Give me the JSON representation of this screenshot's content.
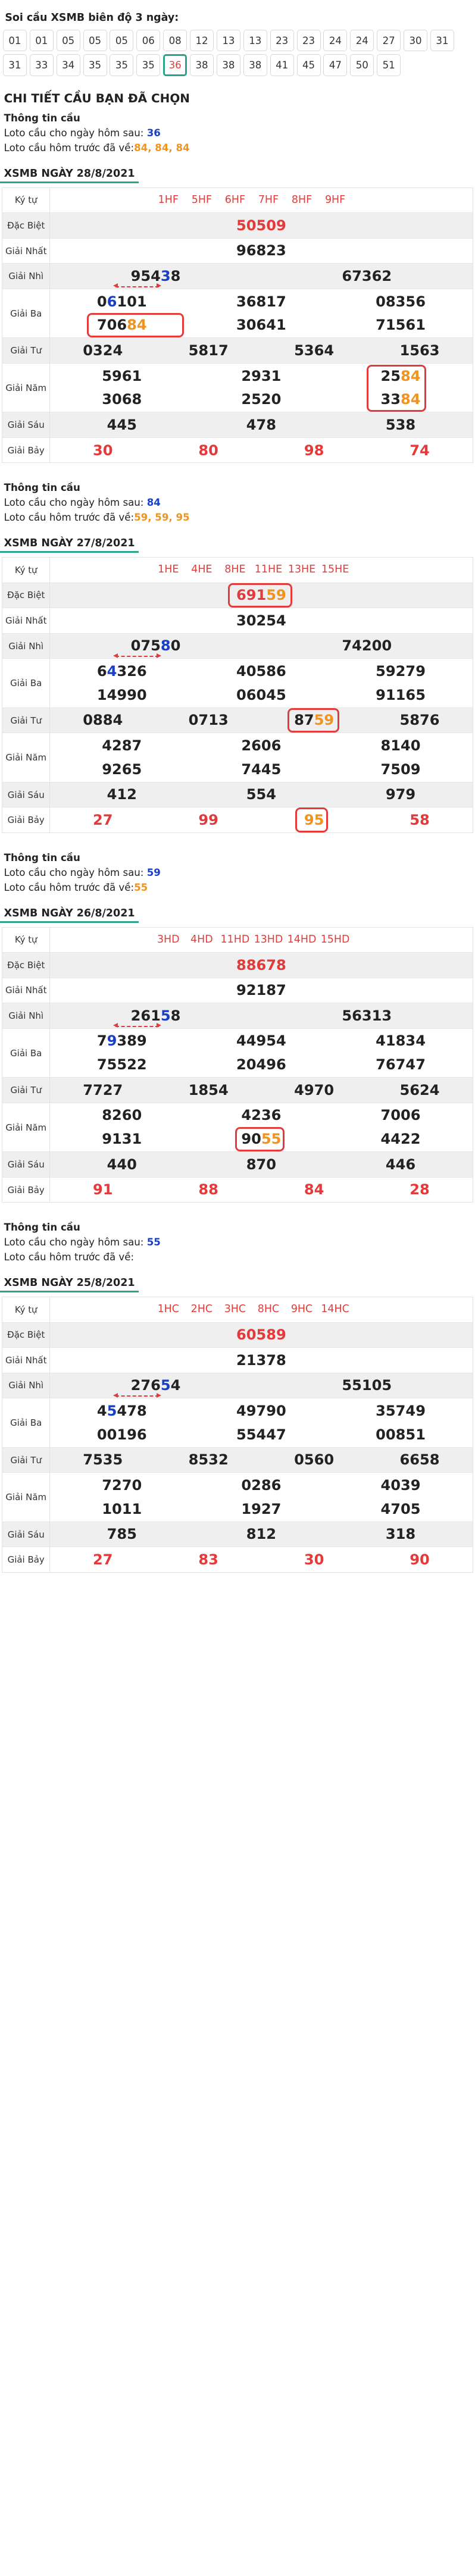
{
  "header": {
    "title": "Soi cầu XSMB biên độ 3 ngày:"
  },
  "chips": {
    "row1": [
      "01",
      "01",
      "05",
      "05",
      "05",
      "06",
      "08",
      "12",
      "13",
      "13",
      "23",
      "23",
      "24",
      "24",
      "27",
      "30",
      "31"
    ],
    "row2": [
      "31",
      "33",
      "34",
      "35",
      "35",
      "35",
      "36",
      "38",
      "38",
      "38",
      "41",
      "45",
      "47",
      "50",
      "51"
    ],
    "selected_index_row2": 6
  },
  "detail_title": "CHI TIẾT CẦU BẠN ĐÃ CHỌN",
  "info_label_next": "Loto cầu cho ngày hôm sau:",
  "info_label_prev": "Loto cầu hôm trước đã về:",
  "info_heading": "Thông tin cầu",
  "labels": {
    "kytu": "Ký tự",
    "db": "Đặc Biệt",
    "g1": "Giải Nhất",
    "g2": "Giải Nhì",
    "g3": "Giải Ba",
    "g4": "Giải Tư",
    "g5": "Giải Năm",
    "g6": "Giải Sáu",
    "g7": "Giải Bảy"
  },
  "sections": [
    {
      "info_next": "36",
      "info_prev": "84, 84, 84",
      "date": "XSMB NGÀY 28/8/2021",
      "kytu": [
        "1HF",
        "5HF",
        "6HF",
        "7HF",
        "8HF",
        "9HF"
      ],
      "db": "50509",
      "g1": "96823",
      "g2": [
        "95438",
        "67362"
      ],
      "g3": [
        "06101",
        "36817",
        "08356",
        "70684",
        "30641",
        "71561"
      ],
      "g4": [
        "0324",
        "5817",
        "5364",
        "1563"
      ],
      "g5": [
        "5961",
        "2931",
        "2584",
        "3068",
        "2520",
        "3384"
      ],
      "g6": [
        "445",
        "478",
        "538"
      ],
      "g7": [
        "30",
        "80",
        "98",
        "74"
      ]
    },
    {
      "info_next": "84",
      "info_prev": "59, 59, 95",
      "date": "XSMB NGÀY 27/8/2021",
      "kytu": [
        "1HE",
        "4HE",
        "8HE",
        "11HE",
        "13HE",
        "15HE"
      ],
      "db": "69159",
      "g1": "30254",
      "g2": [
        "07580",
        "74200"
      ],
      "g3": [
        "64326",
        "40586",
        "59279",
        "14990",
        "06045",
        "91165"
      ],
      "g4": [
        "0884",
        "0713",
        "8759",
        "5876"
      ],
      "g5": [
        "4287",
        "2606",
        "8140",
        "9265",
        "7445",
        "7509"
      ],
      "g6": [
        "412",
        "554",
        "979"
      ],
      "g7": [
        "27",
        "99",
        "95",
        "58"
      ]
    },
    {
      "info_next": "59",
      "info_prev": "55",
      "date": "XSMB NGÀY 26/8/2021",
      "kytu": [
        "3HD",
        "4HD",
        "11HD",
        "13HD",
        "14HD",
        "15HD"
      ],
      "db": "88678",
      "g1": "92187",
      "g2": [
        "26158",
        "56313"
      ],
      "g3": [
        "79389",
        "44954",
        "41834",
        "75522",
        "20496",
        "76747"
      ],
      "g4": [
        "7727",
        "1854",
        "4970",
        "5624"
      ],
      "g5": [
        "8260",
        "4236",
        "7006",
        "9131",
        "9055",
        "4422"
      ],
      "g6": [
        "440",
        "870",
        "446"
      ],
      "g7": [
        "91",
        "88",
        "84",
        "28"
      ]
    },
    {
      "info_next": "55",
      "info_prev": "",
      "date": "XSMB NGÀY 25/8/2021",
      "kytu": [
        "1HC",
        "2HC",
        "3HC",
        "8HC",
        "9HC",
        "14HC"
      ],
      "db": "60589",
      "g1": "21378",
      "g2": [
        "27654",
        "55105"
      ],
      "g3": [
        "45478",
        "49790",
        "35749",
        "00196",
        "55447",
        "00851"
      ],
      "g4": [
        "7535",
        "8532",
        "0560",
        "6658"
      ],
      "g5": [
        "7270",
        "0286",
        "4039",
        "1011",
        "1927",
        "4705"
      ],
      "g6": [
        "785",
        "812",
        "318"
      ],
      "g7": [
        "27",
        "83",
        "30",
        "90"
      ]
    }
  ]
}
